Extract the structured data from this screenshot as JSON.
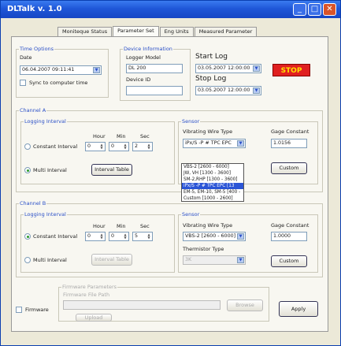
{
  "window": {
    "title": "DLTalk v. 1.0"
  },
  "tabs": [
    "Moniteque Status",
    "Parameter Set",
    "Eng Units",
    "Measured Parameter"
  ],
  "time_options": {
    "title": "Time Options",
    "date_label": "Date",
    "date_value": "06.04.2007 09:11:41",
    "sync_label": "Sync to computer time"
  },
  "device_info": {
    "title": "Device Information",
    "logger_model_label": "Logger Model",
    "logger_model_value": "DL 200",
    "device_id_label": "Device ID",
    "device_id_value": ""
  },
  "start_log": {
    "label": "Start Log",
    "value": "03.05.2007 12:00:00"
  },
  "stop_log": {
    "label": "Stop Log",
    "value": "03.05.2007 12:00:00"
  },
  "stop_button": "STOP",
  "channel_a": {
    "title": "Channel A",
    "logging_title": "Logging Interval",
    "hour_label": "Hour",
    "min_label": "Min",
    "sec_label": "Sec",
    "constant_label": "Constant Interval",
    "hour": "0",
    "min": "0",
    "sec": "2",
    "multi_label": "Multi Interval",
    "interval_table": "Interval Table",
    "sensor_title": "Sensor",
    "vw_type_label": "Vibrating Wire Type",
    "vw_type_value": "iPx/S -P # TPC EPC",
    "gage_label": "Gage Constant",
    "gage_value": "1.0156",
    "custom_button": "Custom",
    "dropdown_options": [
      "VBS-2 [2600 - 6000]",
      "JW, VH [1300 - 3600]",
      "SM-2,RHP [1300 - 3600]",
      "iPx/S -P # TPC EPC [13",
      "EM-5, EM-10, SM-5 [400 -",
      "Custom [1000 - 2600]"
    ],
    "selected_index": 3
  },
  "channel_b": {
    "title": "Channel B",
    "logging_title": "Logging Interval",
    "hour_label": "Hour",
    "min_label": "Min",
    "sec_label": "Sec",
    "constant_label": "Constant Interval",
    "hour": "0",
    "min": "0",
    "sec": "5",
    "multi_label": "Multi Interval",
    "interval_table": "Interval Table",
    "sensor_title": "Sensor",
    "vw_type_label": "Vibrating Wire Type",
    "vw_type_value": "VBS-2 [2600 - 6000]",
    "gage_label": "Gage Constant",
    "gage_value": "1.0000",
    "thermistor_label": "Thermistor Type",
    "thermistor_value": "3K",
    "custom_button": "Custom"
  },
  "firmware": {
    "title": "Firmware Parameters",
    "path_label": "Firmware File Path",
    "path_value": "",
    "browse": "Browse",
    "upload": "Upload",
    "checkbox_label": "Firmware"
  },
  "apply_button": "Apply"
}
